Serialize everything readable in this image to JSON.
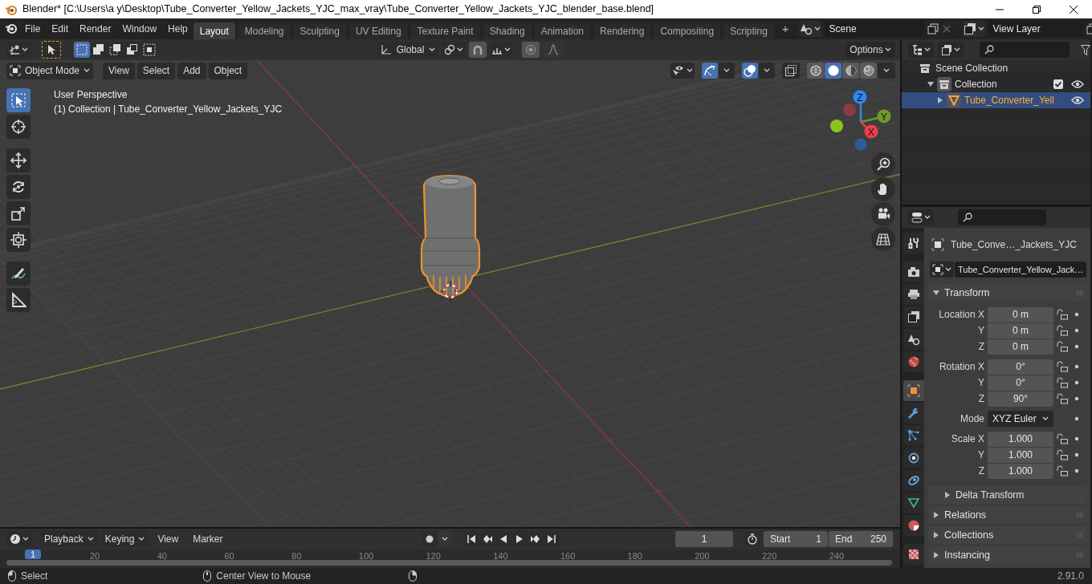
{
  "window": {
    "title": "Blender* [C:\\Users\\a y\\Desktop\\Tube_Converter_Yellow_Jackets_YJC_max_vray\\Tube_Converter_Yellow_Jackets_YJC_blender_base.blend]"
  },
  "menu": [
    "File",
    "Edit",
    "Render",
    "Window",
    "Help"
  ],
  "workspaces": [
    {
      "label": "Layout",
      "selected": true
    },
    {
      "label": "Modeling",
      "selected": false
    },
    {
      "label": "Sculpting",
      "selected": false
    },
    {
      "label": "UV Editing",
      "selected": false
    },
    {
      "label": "Texture Paint",
      "selected": false
    },
    {
      "label": "Shading",
      "selected": false
    },
    {
      "label": "Animation",
      "selected": false
    },
    {
      "label": "Rendering",
      "selected": false
    },
    {
      "label": "Compositing",
      "selected": false
    },
    {
      "label": "Scripting",
      "selected": false
    }
  ],
  "add_workspace": "+",
  "scene": {
    "value": "Scene"
  },
  "view_layer": {
    "value": "View Layer"
  },
  "tool_settings": {
    "select_modes": [
      {
        "selected": true
      },
      {
        "selected": false
      },
      {
        "selected": false
      },
      {
        "selected": false
      },
      {
        "selected": false
      }
    ],
    "orientation": "Global",
    "snap": {
      "on": false
    },
    "proportional": {
      "on": false
    },
    "options": "Options"
  },
  "viewport_header": {
    "mode": "Object Mode",
    "menus": [
      "View",
      "Select",
      "Add",
      "Object"
    ],
    "gizmos": {
      "on": true
    },
    "overlays": {
      "on": true
    },
    "xray": {
      "on": false
    },
    "shading": [
      {
        "selected": false
      },
      {
        "selected": true
      },
      {
        "selected": false
      },
      {
        "selected": false
      }
    ]
  },
  "overlay_text": {
    "view": "User Perspective",
    "info": "(1) Collection | Tube_Converter_Yellow_Jackets_YJC"
  },
  "tools": [
    {
      "kind": "select",
      "selected": true
    },
    {
      "kind": "cursor",
      "selected": false
    },
    {
      "kind": "move",
      "selected": false
    },
    {
      "kind": "rotate",
      "selected": false
    },
    {
      "kind": "scale",
      "selected": false
    },
    {
      "kind": "transform",
      "selected": false
    },
    {
      "kind": "annotate",
      "selected": false
    },
    {
      "kind": "measure",
      "selected": false
    }
  ],
  "gizmo": {
    "axes": [
      "X",
      "Y",
      "Z"
    ]
  },
  "outliner": {
    "items": [
      {
        "kind": "scene",
        "label": "Scene Collection",
        "selected": false,
        "children": [
          {
            "kind": "collection",
            "label": "Collection",
            "selected": false,
            "expanded": true,
            "checked": true,
            "visible": true,
            "children": [
              {
                "kind": "object",
                "label": "Tube_Converter_Yell",
                "selected": true,
                "expanded": false,
                "visible": true
              }
            ]
          }
        ]
      }
    ]
  },
  "properties": {
    "tabs": [
      {
        "kind": "tool",
        "selected": false
      },
      {
        "kind": "render",
        "selected": false
      },
      {
        "kind": "output",
        "selected": false
      },
      {
        "kind": "view_layer",
        "selected": false
      },
      {
        "kind": "scene",
        "selected": false
      },
      {
        "kind": "world",
        "selected": false
      },
      {
        "kind": "object",
        "selected": true
      },
      {
        "kind": "modifiers",
        "selected": false
      },
      {
        "kind": "particles",
        "selected": false
      },
      {
        "kind": "physics",
        "selected": false
      },
      {
        "kind": "constraints",
        "selected": false
      },
      {
        "kind": "data",
        "selected": false
      },
      {
        "kind": "material",
        "selected": false
      },
      {
        "kind": "texture",
        "selected": false
      }
    ],
    "object_name": "Tube_Conve…_Jackets_YJC",
    "data_name": "Tube_Converter_Yellow_Jack…",
    "panels": [
      {
        "kind": "panel",
        "title": "Transform",
        "expanded": true,
        "groups": [
          {
            "rows": [
              {
                "kind": "field",
                "label": "Location X",
                "value": "0 m",
                "locked": false
              },
              {
                "kind": "field",
                "label": "Y",
                "value": "0 m",
                "locked": false
              },
              {
                "kind": "field",
                "label": "Z",
                "value": "0 m",
                "locked": false
              }
            ]
          },
          {
            "rows": [
              {
                "kind": "field",
                "label": "Rotation X",
                "value": "0°",
                "locked": false
              },
              {
                "kind": "field",
                "label": "Y",
                "value": "0°",
                "locked": false
              },
              {
                "kind": "field",
                "label": "Z",
                "value": "90°",
                "locked": false
              }
            ]
          },
          {
            "rows": [
              {
                "kind": "dropdown",
                "label": "Mode",
                "value": "XYZ Euler"
              }
            ]
          },
          {
            "rows": [
              {
                "kind": "field",
                "label": "Scale X",
                "value": "1.000",
                "locked": false
              },
              {
                "kind": "field",
                "label": "Y",
                "value": "1.000",
                "locked": false
              },
              {
                "kind": "field",
                "label": "Z",
                "value": "1.000",
                "locked": false
              }
            ]
          }
        ]
      },
      {
        "kind": "subpanel",
        "title": "Delta Transform",
        "expanded": false
      },
      {
        "kind": "panel",
        "title": "Relations",
        "expanded": false
      },
      {
        "kind": "panel",
        "title": "Collections",
        "expanded": false
      },
      {
        "kind": "panel",
        "title": "Instancing",
        "expanded": false
      }
    ]
  },
  "timeline": {
    "menus": [
      "Playback",
      "Keying",
      "View",
      "Marker"
    ],
    "current_frame": "1",
    "start_label": "Start",
    "start": "1",
    "end_label": "End",
    "end": "250",
    "playhead": "1",
    "ruler": [
      "20",
      "40",
      "60",
      "80",
      "100",
      "120",
      "140",
      "160",
      "180",
      "200",
      "220",
      "240"
    ]
  },
  "status_bar": {
    "hints": [
      "Select",
      "Center View to Mouse"
    ],
    "version": "2.91.0"
  }
}
